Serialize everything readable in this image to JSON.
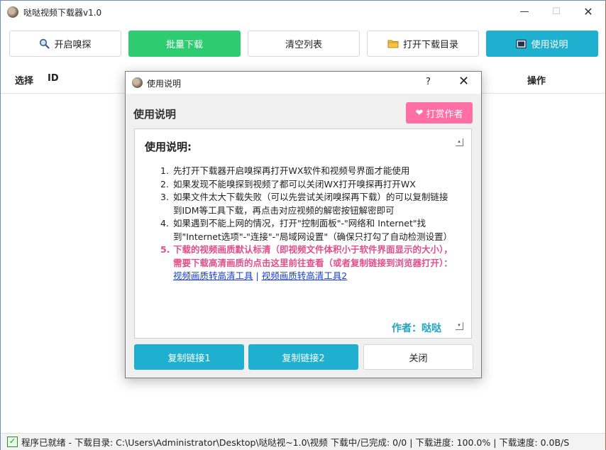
{
  "app": {
    "title": "哒哒视频下载器v1.0"
  },
  "toolbar": {
    "start_sniff": "开启嗅探",
    "batch_download": "批量下载",
    "clear_list": "清空列表",
    "open_dir": "打开下载目录",
    "instructions": "使用说明"
  },
  "table": {
    "col_select": "选择",
    "col_id": "ID",
    "col_action": "操作"
  },
  "statusbar": {
    "text": "程序已就绪 - 下载目录: C:\\Users\\Administrator\\Desktop\\哒哒视~1.0\\视频  下载中/已完成: 0/0 | 下载进度: 100.0% | 下载速度: 0.0B/S"
  },
  "dialog": {
    "title": "使用说明",
    "help": "?",
    "heading": "使用说明",
    "donate": "打赏作者",
    "content_title": "使用说明:",
    "steps": [
      {
        "num": "1.",
        "text": "先打开下载器开启嗅探再打开WX软件和视频号界面才能使用"
      },
      {
        "num": "2.",
        "text": "如果发现不能嗅探到视频了都可以关闭WX打开嗅探再打开WX"
      },
      {
        "num": "3.",
        "text": "如果文件太大下载失败（可以先尝试关闭嗅探再下载）的可以复制链接到IDM等工具下载，再点击对应视频的解密按钮解密即可"
      },
      {
        "num": "4.",
        "text": "如果遇到不能上网的情况，打开\"控制面板\"-\"网络和 Internet\"找到\"Internet选项\"-\"连接\"-\"局域网设置\"（确保只打勾了自动检测设置）"
      },
      {
        "num": "5.",
        "text": "下载的视频画质默认标清（即视频文件体积小于软件界面显示的大小），需要下载高清画质的点击这里前往查看（或者复制链接到浏览器打开）："
      }
    ],
    "link1": "视频画质转高清工具",
    "link_sep": " | ",
    "link2": "视频画质转高清工具2",
    "author": "作者：哒哒",
    "copy1": "复制链接1",
    "copy2": "复制链接2",
    "close": "关闭"
  },
  "colors": {
    "green": "#2ecc71",
    "blue": "#1fb0cf",
    "pink": "#ff6fa6",
    "warn": "#e0508a"
  },
  "icons": [
    "search-icon",
    "folder-icon",
    "book-icon",
    "heart-icon",
    "check-icon"
  ]
}
